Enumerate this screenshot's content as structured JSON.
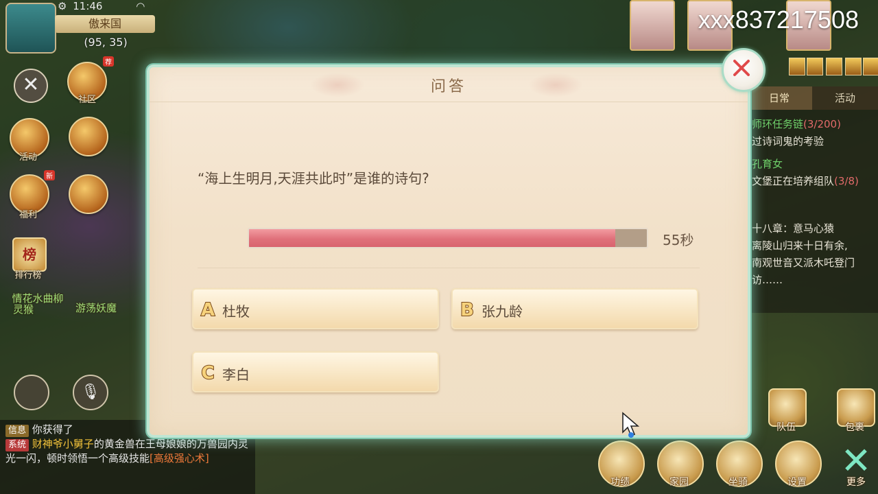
{
  "status_bar": {
    "time": "11:46"
  },
  "location": {
    "zone": "傲来国",
    "coords": "(95, 35)"
  },
  "watermark": "xxx837217508",
  "left_hud": {
    "items": [
      {
        "label": "社区"
      },
      {
        "label": "活动"
      },
      {
        "label": "福利"
      },
      {
        "label": "排行榜"
      }
    ],
    "badge_new": "新",
    "badge_recommend": "荐",
    "rank_char": "榜",
    "npc_names": [
      "情花水曲柳",
      "灵猴",
      "游荡妖魔"
    ]
  },
  "tracker": {
    "tabs": [
      "日常",
      "活动"
    ],
    "lines": [
      {
        "text": "师环任务链",
        "count": "(3/200)"
      },
      {
        "text": "过诗词鬼的考验"
      },
      {
        "text": "孔育女"
      },
      {
        "text": "文堡正在培养组队",
        "count": "(3/8)"
      },
      {
        "text": "十八章：意马心猿"
      },
      {
        "text": "离陵山归来十日有余,"
      },
      {
        "text": "南观世音又派木吒登门"
      },
      {
        "text": "访……"
      }
    ]
  },
  "chat": {
    "lines": [
      {
        "tag": "信息",
        "text": "你获得了"
      },
      {
        "tag": "系统",
        "name": "财神爷小舅子",
        "text": "的黄金兽在王母娘娘的万兽园内灵光一闪，顿时领悟一个高级技能",
        "link": "[高级强心术]"
      }
    ]
  },
  "bottom_menu": [
    "功绩",
    "家园",
    "坐骑",
    "设置",
    "更多"
  ],
  "side_buttons": [
    "队伍",
    "包裹"
  ],
  "dialog": {
    "title": "问答",
    "question": "“海上生明月,天涯共此时”是谁的诗句?",
    "timer": {
      "remaining_text": "55秒",
      "progress": 0.92
    },
    "options": [
      {
        "letter": "A",
        "label": "杜牧"
      },
      {
        "letter": "B",
        "label": "张九龄"
      },
      {
        "letter": "C",
        "label": "李白"
      }
    ]
  }
}
